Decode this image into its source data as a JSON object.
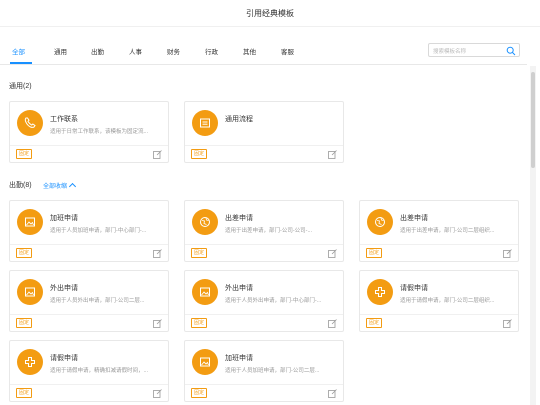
{
  "header": {
    "title": "引用经典模板"
  },
  "tabs": [
    {
      "label": "全部",
      "active": true
    },
    {
      "label": "通用",
      "active": false
    },
    {
      "label": "出勤",
      "active": false
    },
    {
      "label": "人事",
      "active": false
    },
    {
      "label": "财务",
      "active": false
    },
    {
      "label": "行政",
      "active": false
    },
    {
      "label": "其他",
      "active": false
    },
    {
      "label": "客服",
      "active": false
    }
  ],
  "search": {
    "placeholder": "搜索模板名称",
    "icon": "search-icon"
  },
  "sections": [
    {
      "title": "通用(2)",
      "cards": [
        {
          "name": "工作联系",
          "desc": "适用于日常工作联系，该模板为固定流...",
          "badge": "固定",
          "icon": "phone-icon"
        },
        {
          "name": "通用流程",
          "desc": "",
          "badge": "固定",
          "icon": "inbox-icon"
        }
      ]
    },
    {
      "title": "出勤(8)",
      "collapse_label": "全部收缩",
      "cards": [
        {
          "name": "加班申请",
          "desc": "适用于人员加班申请，部门-中心部门-...",
          "badge": "固定",
          "icon": "image-icon"
        },
        {
          "name": "出差申请",
          "desc": "适用于出差申请，部门-公司-公司-...",
          "badge": "固定",
          "icon": "globe-icon"
        },
        {
          "name": "出差申请",
          "desc": "适用于出差申请，部门-公司二层组织...",
          "badge": "固定",
          "icon": "globe-icon"
        },
        {
          "name": "外出申请",
          "desc": "适用于人员外出申请，部门-公司二层...",
          "badge": "固定",
          "icon": "image-icon"
        },
        {
          "name": "外出申请",
          "desc": "适用于人员外出申请，部门-中心部门-...",
          "badge": "固定",
          "icon": "image-icon"
        },
        {
          "name": "请假申请",
          "desc": "适用于请假申请，部门-公司二层组织...",
          "badge": "固定",
          "icon": "plus-icon"
        },
        {
          "name": "请假申请",
          "desc": "适用于请假申请，精确扣减请假时间，...",
          "badge": "固定",
          "icon": "plus-icon"
        },
        {
          "name": "加班申请",
          "desc": "适用于人员加班申请，部门-公司二层...",
          "badge": "固定",
          "icon": "image-icon"
        }
      ]
    }
  ],
  "colors": {
    "accent": "#1890ff",
    "icon_bg": "#f39c12"
  }
}
